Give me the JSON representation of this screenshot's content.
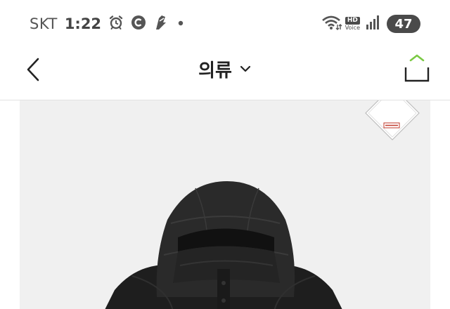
{
  "status_bar": {
    "carrier": "SKT",
    "time": "1:22",
    "icons_left": [
      "alarm-icon",
      "c-circle-icon",
      "notification-app-icon",
      "dot-icon"
    ],
    "icons_right": [
      "wifi-icon",
      "hd-voice-icon",
      "signal-icon"
    ],
    "hd_label": "HD",
    "voice_label": "Voice",
    "battery": "47"
  },
  "header": {
    "title": "의류",
    "back_icon": "chevron-left-icon",
    "dropdown_icon": "chevron-down-icon",
    "share_icon": "share-icon",
    "share_accent": "#7ac943"
  },
  "product": {
    "background": "#f0f0f0",
    "badge": {
      "brand": "WINDSTOPPER",
      "top_text": "BY GORE-TEX LABS",
      "bottom_text": "PRODUCTS"
    },
    "image": "black-padded-hooded-jacket"
  },
  "colors": {
    "text": "#222222",
    "status_text": "#555555",
    "accent": "#7ac943"
  }
}
